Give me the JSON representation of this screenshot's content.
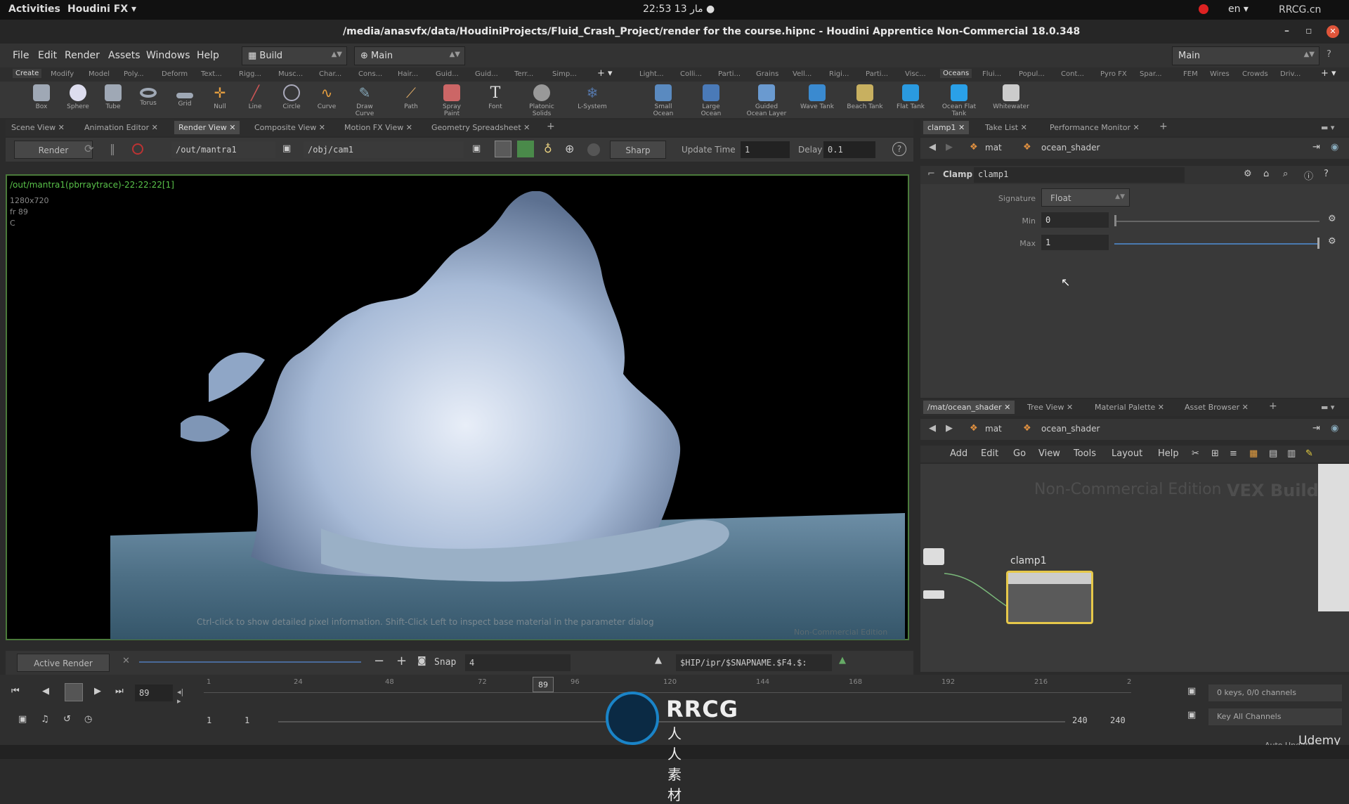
{
  "os": {
    "activities": "Activities",
    "app": "Houdini FX ▾",
    "clock": "22:53 13 مار ●",
    "lang": "en ▾",
    "watermark": "RRCG.cn"
  },
  "window": {
    "title": "/media/anasvfx/data/HoudiniProjects/Fluid_Crash_Project/render for the course.hipnc - Houdini Apprentice Non-Commercial 18.0.348"
  },
  "menu": {
    "items": [
      "File",
      "Edit",
      "Render",
      "Assets",
      "Windows",
      "Help"
    ],
    "desktop": "Build",
    "main": "Main",
    "right_main": "Main"
  },
  "shelf_tabs_left": [
    "Create",
    "Modify",
    "Model",
    "Poly...",
    "Deform",
    "Text...",
    "Rigg...",
    "Musc...",
    "Char...",
    "Cons...",
    "Hair...",
    "Guid...",
    "Guid...",
    "Terr...",
    "Simp..."
  ],
  "shelf_tabs_right": [
    "Light...",
    "Colli...",
    "Parti...",
    "Grains",
    "Vell...",
    "Rigi...",
    "Parti...",
    "Visc...",
    "Oceans",
    "Flui...",
    "Popul...",
    "Cont...",
    "Pyro FX",
    "Spar...",
    "FEM",
    "Wires",
    "Crowds",
    "Driv..."
  ],
  "tools_left": [
    "Box",
    "Sphere",
    "Tube",
    "Torus",
    "Grid",
    "Null",
    "Line",
    "Circle",
    "Curve",
    "Draw Curve",
    "Path",
    "Spray Paint",
    "Font",
    "Platonic Solids",
    "L-System"
  ],
  "tools_right": [
    "Small Ocean",
    "Large Ocean",
    "Guided Ocean Layer",
    "Wave Tank",
    "Beach Tank",
    "Flat Tank",
    "Ocean Flat Tank",
    "Whitewater"
  ],
  "pane_tabs": [
    "Scene View",
    "Animation Editor",
    "Render View",
    "Composite View",
    "Motion FX View",
    "Geometry Spreadsheet"
  ],
  "render_toolbar": {
    "render": "Render",
    "rop": "/out/mantra1",
    "camera": "/obj/cam1",
    "sharp": "Sharp",
    "update_label": "Update Time",
    "update_value": "1",
    "delay_label": "Delay",
    "delay_value": "0.1"
  },
  "viewport": {
    "info": "/out/mantra1(pbrraytrace)-22:22:22[1]",
    "res": "1280x720",
    "frame": "fr 89",
    "channel": "C",
    "note": "Ctrl-click to show detailed pixel information. Shift-Click Left to inspect base material in the parameter dialog",
    "edition": "Non-Commercial Edition"
  },
  "vp_bottom": {
    "active": "Active Render",
    "snap_label": "Snap",
    "snap_value": "4",
    "path": "$HIP/ipr/$SNAPNAME.$F4.$:"
  },
  "right_tabs_top": [
    "clamp1",
    "Take List",
    "Performance Monitor"
  ],
  "right_path_top": {
    "mat": "mat",
    "shader": "ocean_shader"
  },
  "param": {
    "node_type": "Clamp",
    "node_name": "clamp1",
    "signature_label": "Signature",
    "signature_value": "Float",
    "min_label": "Min",
    "min_value": "0",
    "max_label": "Max",
    "max_value": "1",
    "max_fill": 1.0
  },
  "right_tabs_bottom": [
    "/mat/ocean_shader",
    "Tree View",
    "Material Palette",
    "Asset Browser"
  ],
  "right_path_bottom": {
    "mat": "mat",
    "shader": "ocean_shader"
  },
  "net_menu": [
    "Add",
    "Edit",
    "Go",
    "View",
    "Tools",
    "Layout",
    "Help"
  ],
  "network": {
    "edition": "Non-Commercial Edition",
    "context": "VEX Builder",
    "node": "clamp1"
  },
  "timeline": {
    "ticks": [
      "1",
      "24",
      "48",
      "72",
      "96",
      "120",
      "144",
      "168",
      "192",
      "216",
      "2"
    ],
    "current": "89",
    "frame_field": "89",
    "start": "1",
    "start2": "1",
    "end": "240",
    "end2": "240",
    "keys": "0 keys, 0/0 channels",
    "key_all": "Key All Channels",
    "auto_update": "Auto Update"
  },
  "brand": {
    "rrcg": "RRCG",
    "sub": "人人素材",
    "udemy": "Udemy"
  },
  "colors": {
    "accent_green": "#59c24a",
    "node_border": "#e6c84a",
    "close": "#e0553a"
  }
}
